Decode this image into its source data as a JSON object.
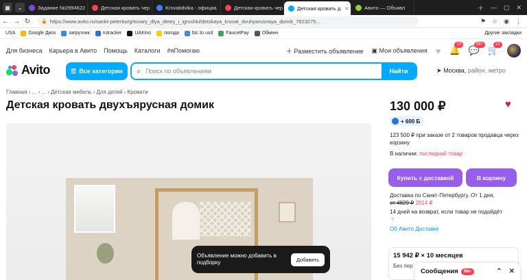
{
  "browser": {
    "tabs": [
      {
        "label": "Задание №2994622",
        "color": "#7a4dd8"
      },
      {
        "label": "Детская кровать чер",
        "color": "#ff4053"
      },
      {
        "label": "Krovatidvika - официа",
        "color": "#3b82f6"
      },
      {
        "label": "Детская кровать чер",
        "color": "#ff4053"
      },
      {
        "label": "Детская кровать д",
        "color": "#00aaff"
      },
      {
        "label": "Авито — Объявл",
        "color": "#97cf26"
      }
    ],
    "active_tab_index": 4,
    "url": "https://www.avito.ru/sankt-peterburg/tovary_dlya_detey_i_igrushki/detskaya_krovat_dvuhyarusnaya_domik_7823275...",
    "bookmarks": [
      "USA",
      "Google Диск",
      "загрузчик",
      "rutracker",
      "UAKino",
      "погода",
      "btc to usd",
      "FaucetPay",
      "Обмінн"
    ],
    "bookmarks_other": "Другие закладки"
  },
  "site": {
    "topnav": [
      "Для бизнеса",
      "Карьера в Авито",
      "Помощь",
      "Каталоги",
      "#яПомогаю"
    ],
    "post_ad": "Разместить объявление",
    "my_ads": "Мои объявления",
    "notif_count": "13",
    "msg_count": "99+",
    "cart_count": "15",
    "logo": "Avito",
    "categories_btn": "Все категории",
    "search_placeholder": "Поиск по объявлениям",
    "search_btn": "Найти",
    "location": "Москва,",
    "location_hint": "район, метро"
  },
  "listing": {
    "breadcrumbs": "Главная  ›  ...  ›  ...  ›  Детская мебель  ›  Для детей  ›  Кровати",
    "title": "Детская кровать двухъярусная домик",
    "price": "130 000 ₽",
    "bonus": "+ 600 Б",
    "bulk_offer": "123 500 ₽ при заказе от 2 товаров продавца через корзину",
    "availability_label": "В наличии:",
    "availability_value": "последний товар",
    "buy_delivery": "Купить с доставкой",
    "to_cart": "В корзину",
    "delivery_line1": "Доставка по Санкт-Петербургу. От 1 дня,",
    "delivery_old_price": "от 4829 ₽",
    "delivery_new_price": "2014 ₽",
    "return_policy": "14 дней на возврат, если товар не подойдёт",
    "delivery_link": "Об Авито Доставке",
    "credit_value": "15 942 ₽ × 10 месяцев",
    "credit_sub": "Без пер",
    "toast_text": "Объявление можно добавить в подборку",
    "toast_btn": "Добавить"
  },
  "chat": {
    "label": "Сообщения",
    "count": "99+"
  }
}
